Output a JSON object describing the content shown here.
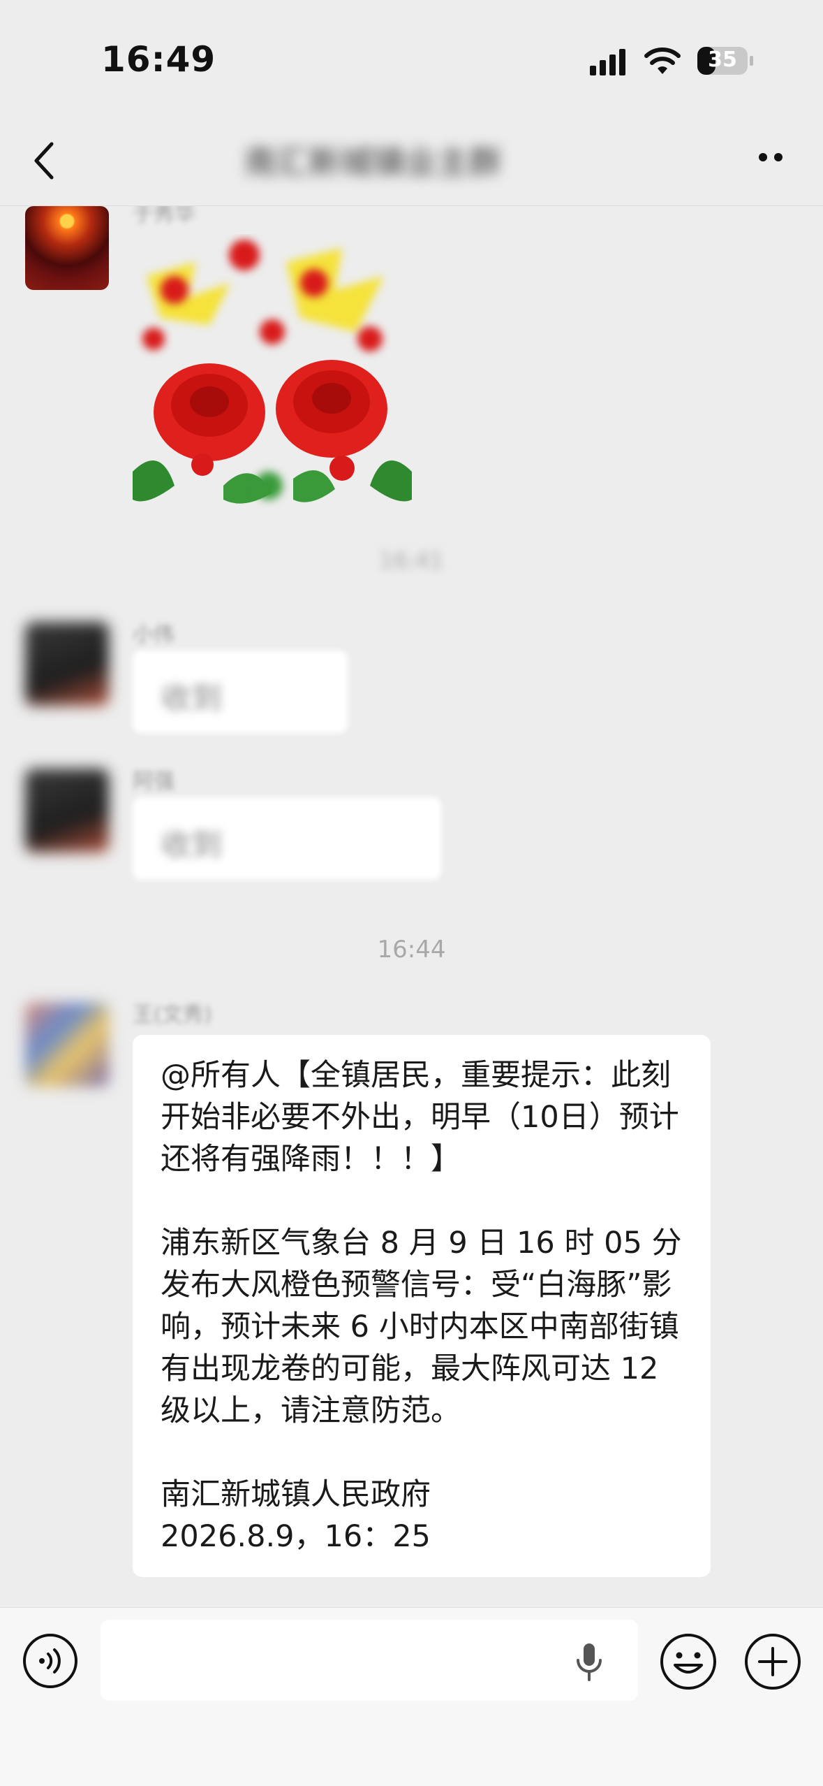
{
  "status_bar": {
    "time": "16:49",
    "battery": "35"
  },
  "header": {
    "title": "南汇新城镇业主群"
  },
  "chat": {
    "sticker_sender": "于秀华",
    "blurred_time": "16:41",
    "msg1": {
      "sender": "小伟",
      "text": "收到"
    },
    "msg2": {
      "sender": "阿强",
      "text": "收到"
    },
    "time_separator": "16:44",
    "msg3_sender": "王(文秀)",
    "announcement": {
      "para1": "@所有人【全镇居民，重要提示：此刻开始非必要不外出，明早（10日）预计还将有强降雨！！！】",
      "para2": "浦东新区气象台 8 月 9 日 16 时 05 分发布大风橙色预警信号：受“白海豚”影响，预计未来 6 小时内本区中南部街镇有出现龙卷的可能，最大阵风可达 12 级以上，请注意防范。",
      "signature": "南汇新城镇人民政府",
      "date": "2026.8.9，16：25"
    }
  },
  "input_bar": {
    "placeholder": ""
  },
  "icons": [
    "back-icon",
    "more-icon",
    "voice-icon",
    "microphone-icon",
    "emoji-icon",
    "plus-icon"
  ]
}
